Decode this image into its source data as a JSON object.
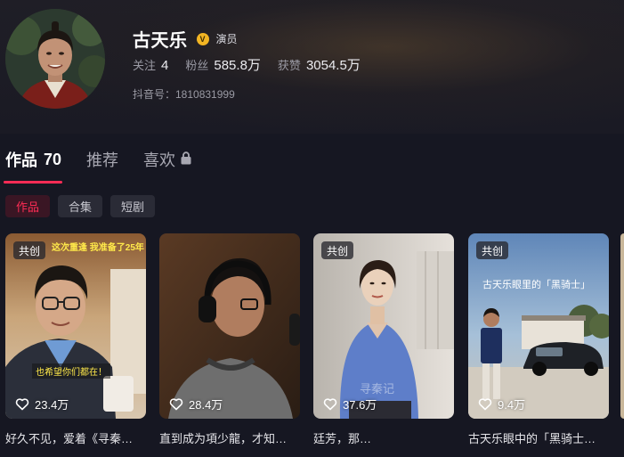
{
  "profile": {
    "name": "古天乐",
    "verified_label": "演员",
    "verified_glyph": "V",
    "stats": [
      {
        "label": "关注",
        "value": "4"
      },
      {
        "label": "粉丝",
        "value": "585.8万"
      },
      {
        "label": "获赞",
        "value": "3054.5万"
      }
    ],
    "douyin_id": "抖音号：1810831999"
  },
  "tabs": [
    {
      "label": "作品",
      "count": "70",
      "active": true
    },
    {
      "label": "推荐",
      "active": false
    },
    {
      "label": "喜欢",
      "active": false,
      "icon": "lock-icon"
    }
  ],
  "pills": [
    {
      "label": "作品",
      "active": true
    },
    {
      "label": "合集",
      "active": false
    },
    {
      "label": "短剧",
      "active": false
    }
  ],
  "videos": [
    {
      "badge": "共创",
      "overlay_top": "这次重逢  我准备了25年",
      "overlay_bottom": "也希望你们都在！",
      "likes": "23.4万",
      "title": "好久不见，爱着《寻秦…"
    },
    {
      "badge": "",
      "likes": "28.4万",
      "title": "直到成为項少龍，才知…"
    },
    {
      "badge": "共创",
      "watermark": "寻秦记",
      "likes": "37.6万",
      "title": "廷芳，那…"
    },
    {
      "badge": "共创",
      "overlay_caption": "古天乐眼里的「黑骑士」",
      "likes": "9.4万",
      "title": "古天乐眼中的「黑骑士…"
    }
  ],
  "colors": {
    "background": "#161722",
    "accent": "#fe2c55",
    "verified": "#f2b523"
  }
}
